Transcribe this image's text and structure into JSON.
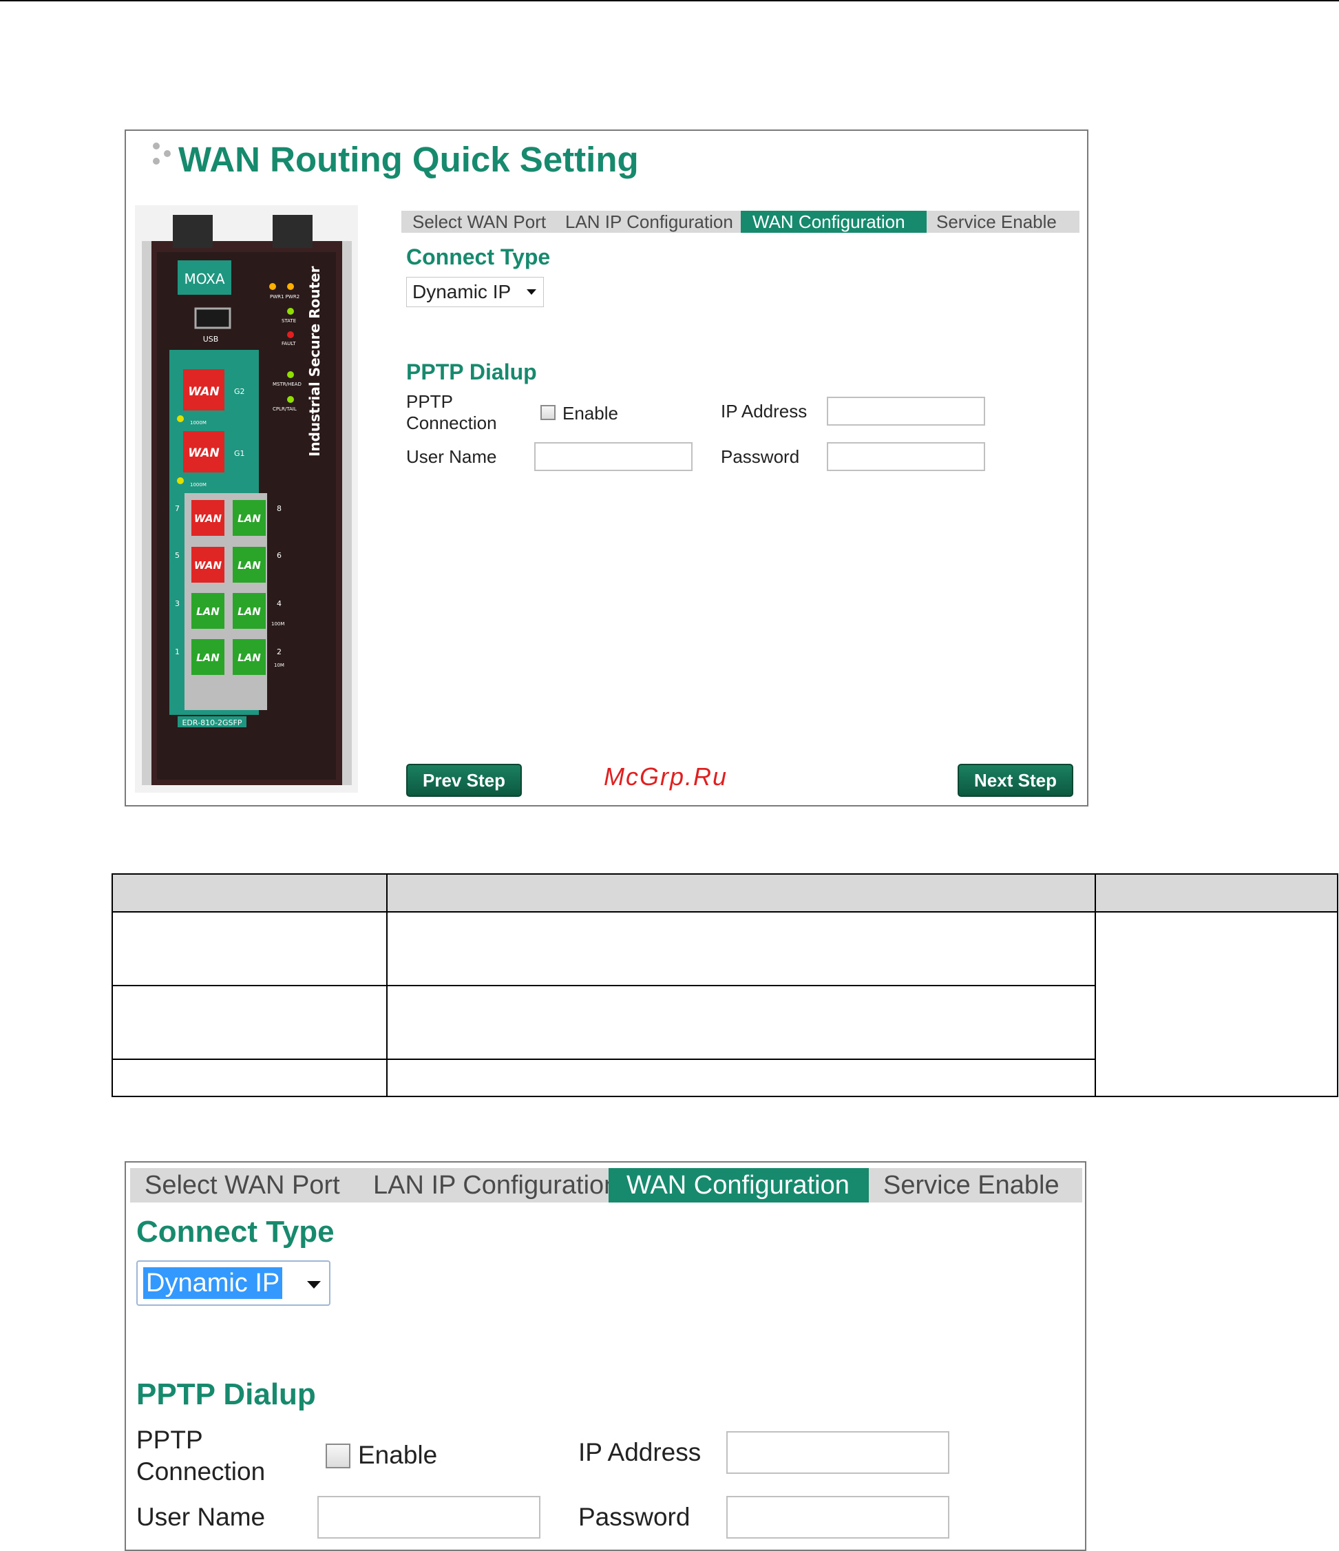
{
  "wizard": {
    "title": "WAN Routing Quick Setting",
    "tabs": [
      "Select WAN Port",
      "LAN IP Configuration",
      "WAN  Configuration",
      "Service Enable"
    ],
    "active_tab_index": 2,
    "connect_type": {
      "heading": "Connect Type",
      "selected": "Dynamic IP"
    },
    "pptp": {
      "heading": "PPTP Dialup",
      "connection_label_line1": "PPTP",
      "connection_label_line2": "Connection",
      "enable_label": "Enable",
      "enable_checked": false,
      "ip_address_label": "IP Address",
      "ip_address_value": "",
      "user_name_label": "User Name",
      "user_name_value": "",
      "password_label": "Password",
      "password_value": ""
    },
    "buttons": {
      "prev": "Prev Step",
      "next": "Next Step"
    }
  },
  "device": {
    "brand": "MOXA",
    "product_label": "Industrial Secure Router",
    "model": "EDR-810-2GSFP",
    "usb_label": "USB",
    "led_labels": [
      "PWR1",
      "PWR2",
      "STATE",
      "FAULT",
      "MSTR/HEAD",
      "CPLR/TAIL"
    ],
    "sfp_ports": [
      {
        "label": "WAN",
        "id": "G2",
        "speed": "1000M"
      },
      {
        "label": "WAN",
        "id": "G1",
        "speed": "1000M"
      }
    ],
    "rj45_ports": [
      {
        "num": "7",
        "label": "WAN"
      },
      {
        "num": "8",
        "label": "LAN"
      },
      {
        "num": "5",
        "label": "WAN"
      },
      {
        "num": "6",
        "label": "LAN"
      },
      {
        "num": "3",
        "label": "LAN"
      },
      {
        "num": "4",
        "label": "LAN"
      },
      {
        "num": "1",
        "label": "LAN"
      },
      {
        "num": "2",
        "label": "LAN"
      }
    ],
    "speed_labels": [
      "100M",
      "10M"
    ]
  },
  "watermark": "McGrp.Ru",
  "colors": {
    "accent": "#178a6e",
    "tab_bg": "#d9d9d9",
    "button_dark": "#0c5a40",
    "wan_red": "#e02525",
    "lan_green": "#2aa52a",
    "watermark": "#e02020"
  }
}
